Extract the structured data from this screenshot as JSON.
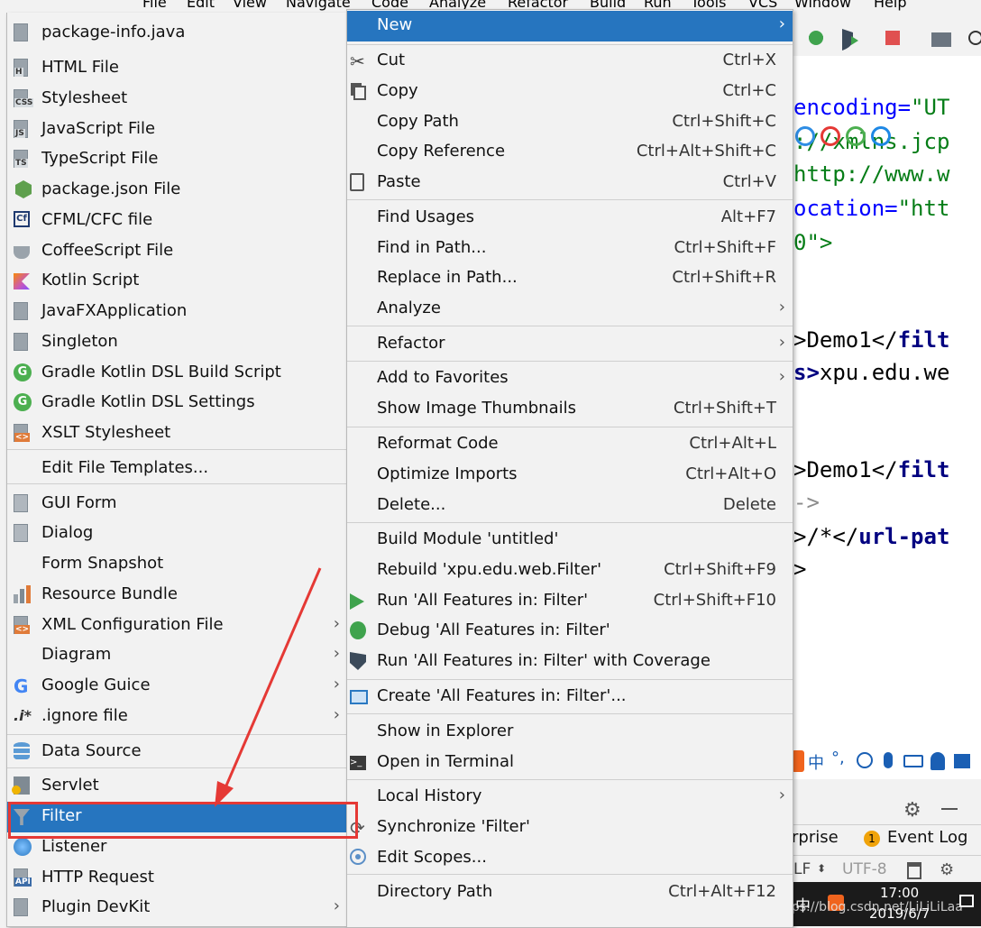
{
  "menubar": [
    "File",
    "Edit",
    "View",
    "Navigate",
    "Code",
    "Analyze",
    "Refactor",
    "Build",
    "Run",
    "Tools",
    "VCS",
    "Window",
    "Help"
  ],
  "new_submenu": [
    {
      "label": "package-info.java",
      "icon": "java-file-icon"
    },
    {
      "label": "HTML File",
      "icon": "html-file-icon",
      "badge": "H"
    },
    {
      "label": "Stylesheet",
      "icon": "css-file-icon",
      "badge": "CSS"
    },
    {
      "label": "JavaScript File",
      "icon": "js-file-icon",
      "badge": "JS"
    },
    {
      "label": "TypeScript File",
      "icon": "ts-file-icon",
      "badge": "TS"
    },
    {
      "label": "package.json File",
      "icon": "nodejs-icon"
    },
    {
      "label": "CFML/CFC file",
      "icon": "cfml-icon",
      "badge": "Cf"
    },
    {
      "label": "CoffeeScript File",
      "icon": "coffeescript-icon"
    },
    {
      "label": "Kotlin Script",
      "icon": "kotlin-icon"
    },
    {
      "label": "JavaFXApplication",
      "icon": "java-file-icon"
    },
    {
      "label": "Singleton",
      "icon": "java-file-icon"
    },
    {
      "label": "Gradle Kotlin DSL Build Script",
      "icon": "gradle-icon"
    },
    {
      "label": "Gradle Kotlin DSL Settings",
      "icon": "gradle-icon"
    },
    {
      "label": "XSLT Stylesheet",
      "icon": "xslt-icon"
    },
    {
      "label": "Edit File Templates...",
      "icon": ""
    },
    {
      "label": "GUI Form",
      "icon": "gui-form-icon"
    },
    {
      "label": "Dialog",
      "icon": "dialog-icon"
    },
    {
      "label": "Form Snapshot",
      "icon": ""
    },
    {
      "label": "Resource Bundle",
      "icon": "resource-bundle-icon"
    },
    {
      "label": "XML Configuration File",
      "icon": "xml-config-icon",
      "submenu": true
    },
    {
      "label": "Diagram",
      "icon": "",
      "submenu": true
    },
    {
      "label": "Google Guice",
      "icon": "google-icon",
      "submenu": true
    },
    {
      "label": ".ignore file",
      "icon": "ignore-file-icon",
      "submenu": true
    },
    {
      "label": "Data Source",
      "icon": "database-icon"
    },
    {
      "label": "Servlet",
      "icon": "servlet-icon"
    },
    {
      "label": "Filter",
      "icon": "filter-icon",
      "selected": true
    },
    {
      "label": "Listener",
      "icon": "listener-icon"
    },
    {
      "label": "HTTP Request",
      "icon": "api-icon",
      "badge": "API"
    },
    {
      "label": "Plugin DevKit",
      "icon": "java-file-icon",
      "submenu": true
    }
  ],
  "context_menu": [
    {
      "label": "New",
      "shortcut": "",
      "submenu": true,
      "selected": true
    },
    {
      "label": "Cut",
      "shortcut": "Ctrl+X",
      "icon": "scissors-icon"
    },
    {
      "label": "Copy",
      "shortcut": "Ctrl+C",
      "icon": "copy-icon"
    },
    {
      "label": "Copy Path",
      "shortcut": "Ctrl+Shift+C"
    },
    {
      "label": "Copy Reference",
      "shortcut": "Ctrl+Alt+Shift+C"
    },
    {
      "label": "Paste",
      "shortcut": "Ctrl+V",
      "icon": "paste-icon"
    },
    {
      "label": "Find Usages",
      "shortcut": "Alt+F7"
    },
    {
      "label": "Find in Path...",
      "shortcut": "Ctrl+Shift+F"
    },
    {
      "label": "Replace in Path...",
      "shortcut": "Ctrl+Shift+R"
    },
    {
      "label": "Analyze",
      "shortcut": "",
      "submenu": true
    },
    {
      "label": "Refactor",
      "shortcut": "",
      "submenu": true
    },
    {
      "label": "Add to Favorites",
      "shortcut": "",
      "submenu": true
    },
    {
      "label": "Show Image Thumbnails",
      "shortcut": "Ctrl+Shift+T"
    },
    {
      "label": "Reformat Code",
      "shortcut": "Ctrl+Alt+L"
    },
    {
      "label": "Optimize Imports",
      "shortcut": "Ctrl+Alt+O"
    },
    {
      "label": "Delete...",
      "shortcut": "Delete"
    },
    {
      "label": "Build Module 'untitled'",
      "shortcut": ""
    },
    {
      "label": "Rebuild 'xpu.edu.web.Filter'",
      "shortcut": "Ctrl+Shift+F9"
    },
    {
      "label": "Run 'All Features in: Filter'",
      "shortcut": "Ctrl+Shift+F10",
      "icon": "run-icon"
    },
    {
      "label": "Debug 'All Features in: Filter'",
      "shortcut": "",
      "icon": "debug-icon"
    },
    {
      "label": "Run 'All Features in: Filter' with Coverage",
      "shortcut": "",
      "icon": "coverage-icon"
    },
    {
      "label": "Create 'All Features in: Filter'...",
      "shortcut": "",
      "icon": "create-config-icon"
    },
    {
      "label": "Show in Explorer",
      "shortcut": ""
    },
    {
      "label": "Open in Terminal",
      "shortcut": "",
      "icon": "terminal-icon"
    },
    {
      "label": "Local History",
      "shortcut": "",
      "submenu": true
    },
    {
      "label": "Synchronize 'Filter'",
      "shortcut": "",
      "icon": "sync-icon"
    },
    {
      "label": "Edit Scopes...",
      "shortcut": "",
      "icon": "scopes-icon"
    },
    {
      "label": "Directory Path",
      "shortcut": "Ctrl+Alt+F12"
    }
  ],
  "editor": {
    "lines": [
      {
        "parts": [
          {
            "t": "encoding=",
            "c": "attr"
          },
          {
            "t": "\"UT",
            "c": "str"
          }
        ]
      },
      {
        "parts": [
          {
            "t": "://xmlns.jcp",
            "c": "str"
          }
        ]
      },
      {
        "parts": [
          {
            "t": "http://www.w",
            "c": "str"
          }
        ]
      },
      {
        "parts": [
          {
            "t": "ocation=",
            "c": "attr"
          },
          {
            "t": "\"htt",
            "c": "str"
          }
        ]
      },
      {
        "parts": [
          {
            "t": "0\">",
            "c": "str"
          }
        ]
      },
      {
        "parts": [
          {
            "t": ">Demo1</",
            "c": "txt"
          },
          {
            "t": "filt",
            "c": "tag"
          }
        ]
      },
      {
        "parts": [
          {
            "t": "s>",
            "c": "tag"
          },
          {
            "t": "xpu.edu.we",
            "c": "txt"
          }
        ]
      },
      {
        "parts": [
          {
            "t": ">Demo1</",
            "c": "txt"
          },
          {
            "t": "filt",
            "c": "tag"
          }
        ]
      },
      {
        "parts": [
          {
            "t": "->",
            "c": "com"
          }
        ]
      },
      {
        "parts": [
          {
            "t": ">/*</",
            "c": "txt"
          },
          {
            "t": "url-pat",
            "c": "tag"
          }
        ]
      },
      {
        "parts": [
          {
            "t": ">",
            "c": "txt"
          }
        ]
      }
    ]
  },
  "bottom": {
    "tab_enterprise": "rprise",
    "event_log_count": "1",
    "event_log": "Event Log",
    "line_sep": "LF",
    "encoding": "UTF-8"
  },
  "ime": {
    "lang": "中"
  },
  "taskbar": {
    "time": "17:00",
    "date": "2019/6/7",
    "ime": "中",
    "watermark": "https://blog.csdn.net/LiLiLiLaa"
  },
  "colors": {
    "selection": "#2675bf",
    "highlight_box": "#e53935",
    "annotation_arrow": "#e53935"
  }
}
